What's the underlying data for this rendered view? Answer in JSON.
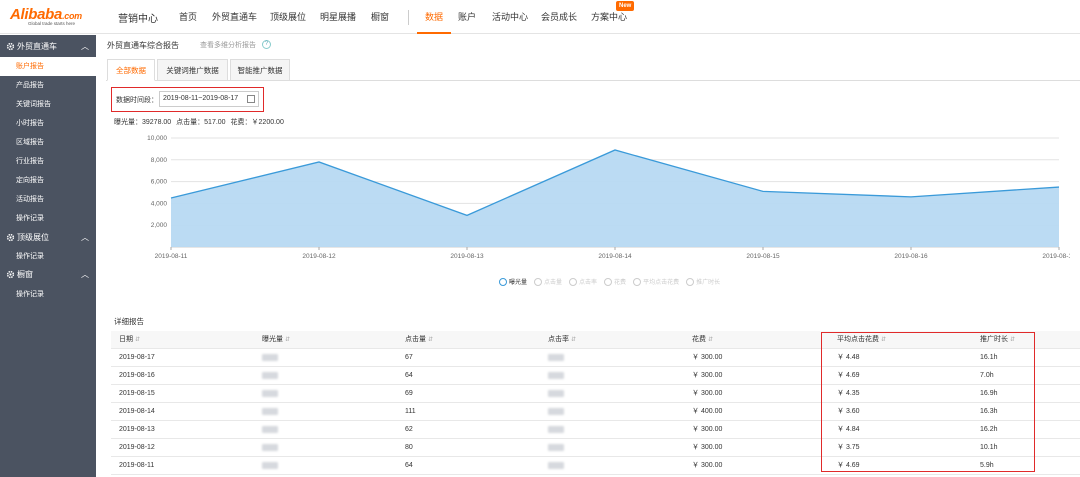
{
  "header": {
    "logo_text": "Alibaba",
    "logo_suffix": ".com",
    "logo_tagline": "Global trade starts here",
    "title": "营销中心",
    "nav": [
      "首页",
      "外贸直通车",
      "顶级展位",
      "明星展播",
      "橱窗",
      "数据",
      "账户",
      "活动中心",
      "会员成长",
      "方案中心"
    ],
    "active_nav": "数据",
    "new_badge": "New",
    "accent_color": "#ff6a00"
  },
  "sidebar": {
    "groups": [
      {
        "label": "外贸直通车",
        "icon": "gear-icon",
        "items": [
          "账户报告",
          "产品报告",
          "关键词报告",
          "小时报告",
          "区域报告",
          "行业报告",
          "定向报告",
          "活动报告",
          "操作记录"
        ]
      },
      {
        "label": "顶级展位",
        "icon": "gear-icon",
        "items": [
          "操作记录"
        ]
      },
      {
        "label": "橱窗",
        "icon": "gear-icon",
        "items": [
          "操作记录"
        ]
      }
    ],
    "active_item": "账户报告",
    "bg_color": "#4b5361"
  },
  "main": {
    "breadcrumb": "外贸直通车综合报告",
    "secondary_link": "查看多维分析报告",
    "tabs": [
      "全部数据",
      "关键词推广数据",
      "智能推广数据"
    ],
    "active_tab": "全部数据",
    "date_label": "数据时间段：",
    "date_value": "2019-08-11~2019-08-17",
    "summary": {
      "impressions": "曝光量：39278.00",
      "clicks": "点击量：517.00",
      "spend": "花费：￥2200.00"
    }
  },
  "chart_data": {
    "type": "area",
    "x": [
      "2019-08-11",
      "2019-08-12",
      "2019-08-13",
      "2019-08-14",
      "2019-08-15",
      "2019-08-16",
      "2019-08-17"
    ],
    "series": [
      {
        "name": "曝光量",
        "values": [
          4500,
          7800,
          2900,
          8900,
          5100,
          4600,
          5500
        ]
      }
    ],
    "yticks": [
      "2,000",
      "4,000",
      "6,000",
      "8,000",
      "10,000"
    ],
    "ylim": [
      0,
      10000
    ],
    "grid": true,
    "line_color": "#3a9ad9",
    "fill_color": "#b7d9f2",
    "legend_position": "bottom-center",
    "legend": [
      {
        "label": "曝光量",
        "on": true
      },
      {
        "label": "点击量",
        "on": false
      },
      {
        "label": "点击率",
        "on": false
      },
      {
        "label": "花费",
        "on": false
      },
      {
        "label": "平均点击花费",
        "on": false
      },
      {
        "label": "推广时长",
        "on": false
      }
    ]
  },
  "table": {
    "title": "详细报告",
    "columns": [
      "日期",
      "曝光量",
      "点击量",
      "点击率",
      "花费",
      "平均点击花费",
      "推广时长"
    ],
    "rows": [
      {
        "date": "2019-08-17",
        "clicks": "67",
        "spend": "￥ 300.00",
        "cpc": "￥ 4.48",
        "duration": "16.1h"
      },
      {
        "date": "2019-08-16",
        "clicks": "64",
        "spend": "￥ 300.00",
        "cpc": "￥ 4.69",
        "duration": "7.0h"
      },
      {
        "date": "2019-08-15",
        "clicks": "69",
        "spend": "￥ 300.00",
        "cpc": "￥ 4.35",
        "duration": "16.9h"
      },
      {
        "date": "2019-08-14",
        "clicks": "111",
        "spend": "￥ 400.00",
        "cpc": "￥ 3.60",
        "duration": "16.3h"
      },
      {
        "date": "2019-08-13",
        "clicks": "62",
        "spend": "￥ 300.00",
        "cpc": "￥ 4.84",
        "duration": "16.2h"
      },
      {
        "date": "2019-08-12",
        "clicks": "80",
        "spend": "￥ 300.00",
        "cpc": "￥ 3.75",
        "duration": "10.1h"
      },
      {
        "date": "2019-08-11",
        "clicks": "64",
        "spend": "￥ 300.00",
        "cpc": "￥ 4.69",
        "duration": "5.9h"
      }
    ],
    "sort_icon": "sort-icon"
  },
  "annotation_color": "#e02a2a"
}
